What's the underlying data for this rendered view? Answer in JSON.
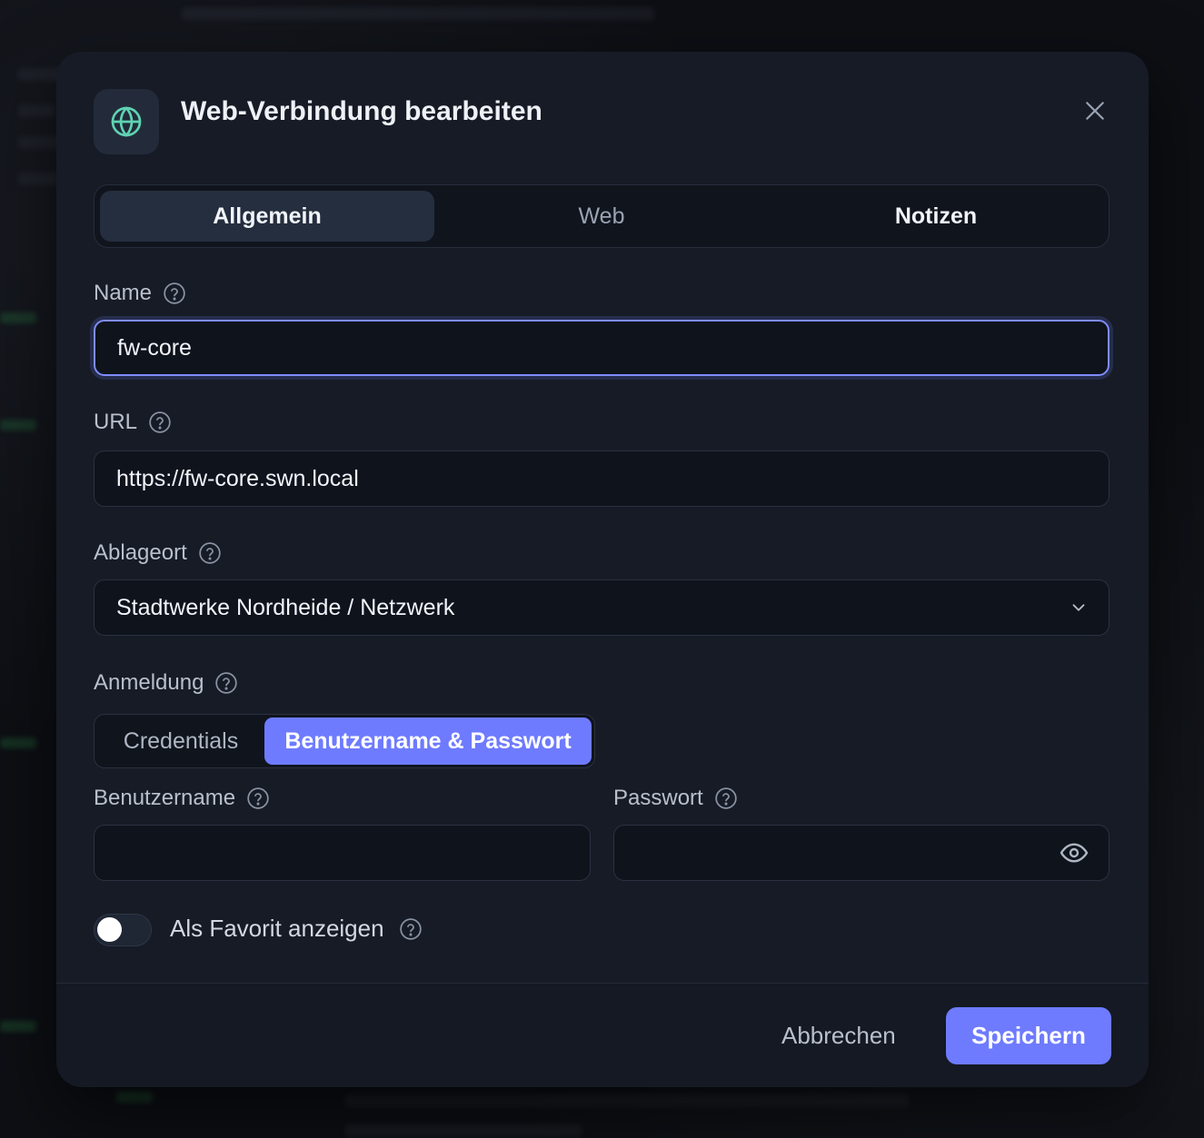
{
  "dialog": {
    "title": "Web-Verbindung bearbeiten",
    "icon": "globe-icon",
    "accent_color": "#6e7bff",
    "icon_color": "#5fd3b3"
  },
  "tabs": [
    {
      "label": "Allgemein",
      "active": true
    },
    {
      "label": "Web",
      "active": false
    },
    {
      "label": "Notizen",
      "active": false
    }
  ],
  "fields": {
    "name": {
      "label": "Name",
      "value": "fw-core"
    },
    "url": {
      "label": "URL",
      "value": "https://fw-core.swn.local"
    },
    "location": {
      "label": "Ablageort",
      "value": "Stadtwerke Nordheide / Netzwerk"
    },
    "login": {
      "label": "Anmeldung",
      "options": [
        "Credentials",
        "Benutzername & Passwort"
      ],
      "selected": "Benutzername & Passwort"
    },
    "username": {
      "label": "Benutzername",
      "value": ""
    },
    "password": {
      "label": "Passwort",
      "value": ""
    }
  },
  "favorite": {
    "label": "Als Favorit anzeigen",
    "enabled": false
  },
  "footer": {
    "cancel_label": "Abbrechen",
    "save_label": "Speichern"
  }
}
